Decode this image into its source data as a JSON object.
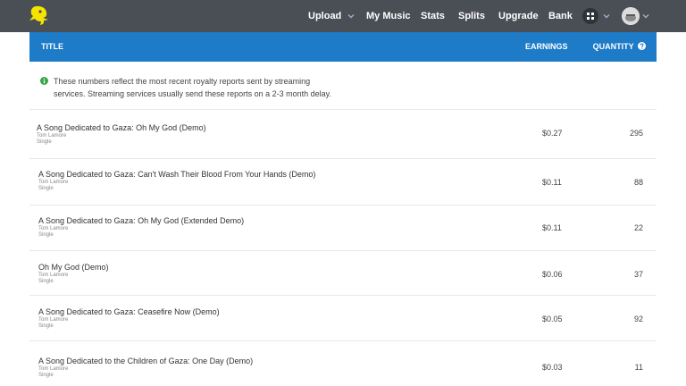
{
  "nav": {
    "upload": "Upload",
    "my_music": "My Music",
    "stats": "Stats",
    "splits": "Splits",
    "upgrade": "Upgrade",
    "bank": "Bank"
  },
  "table": {
    "col_title": "TITLE",
    "col_earnings": "EARNINGS",
    "col_quantity": "QUANTITY"
  },
  "notice": "These numbers reflect the most recent royalty reports sent by streaming services. Streaming services usually send these reports on a 2-3 month delay.",
  "rows": [
    {
      "title": "A Song Dedicated to Gaza: Oh My God (Demo)",
      "artist": "Tom Lamore",
      "type": "Single",
      "earnings": "$0.27",
      "quantity": "295"
    },
    {
      "title": "A Song Dedicated to Gaza: Can't Wash Their Blood From Your Hands (Demo)",
      "artist": "Tom Lamore",
      "type": "Single",
      "earnings": "$0.11",
      "quantity": "88"
    },
    {
      "title": "A Song Dedicated to Gaza: Oh My God (Extended Demo)",
      "artist": "Tom Lamore",
      "type": "Single",
      "earnings": "$0.11",
      "quantity": "22"
    },
    {
      "title": "Oh My God (Demo)",
      "artist": "Tom Lamore",
      "type": "Single",
      "earnings": "$0.06",
      "quantity": "37"
    },
    {
      "title": "A Song Dedicated to Gaza: Ceasefire Now (Demo)",
      "artist": "Tom Lamore",
      "type": "Single",
      "earnings": "$0.05",
      "quantity": "92"
    },
    {
      "title": "A Song Dedicated to the Children of Gaza: One Day (Demo)",
      "artist": "Tom Lamore",
      "type": "Single",
      "earnings": "$0.03",
      "quantity": "11"
    }
  ],
  "colors": {
    "navbar": "#4a4e55",
    "header": "#1d7bc7",
    "info_green": "#3aa54a",
    "logo_yellow": "#f4e400"
  }
}
